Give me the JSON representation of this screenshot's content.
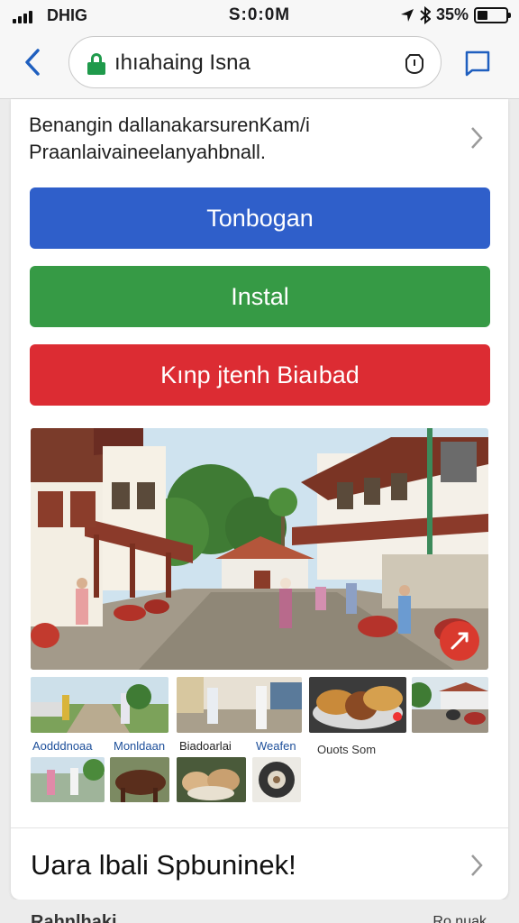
{
  "status_bar": {
    "carrier": "DHIG",
    "time": "S:0:0M",
    "battery_text": "35%",
    "battery_level": 0.35
  },
  "browser": {
    "url": "ıhıahaing Isna"
  },
  "card": {
    "message": "Benangin dallanakarsurenKam/i Praanlaivaineelanyahbnall.",
    "buttons": {
      "primary": "Tonbogan",
      "secondary": "Instal",
      "danger": "Kınp jtenh Biaıbad"
    },
    "thumb_labels": [
      "Aodddnoaa",
      "Monldaan",
      "Biadoarlai",
      "Weafen",
      "Ouots Som"
    ],
    "section_title": "Uara lbali Spbuninek!"
  },
  "bottom_peek": {
    "left": "Rahnlhaki",
    "right": "Ro.nuak"
  },
  "colors": {
    "primary_button": "#2f5fca",
    "secondary_button": "#369a45",
    "danger_button": "#dc2c33",
    "thumb_label_link": "#1d4f9a",
    "lock": "#1f9a4b"
  },
  "icons": [
    "cellular-signal-icon",
    "location-arrow-icon",
    "bluetooth-icon",
    "battery-icon",
    "back-chevron-icon",
    "lock-icon",
    "shield-icon",
    "tabs-icon",
    "chevron-right-icon",
    "share-icon"
  ]
}
